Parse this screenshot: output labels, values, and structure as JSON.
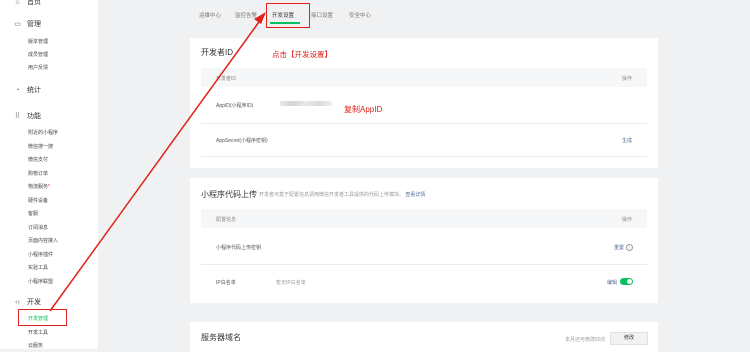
{
  "sidebar": {
    "top_partial": "首页",
    "manage": {
      "label": "管理",
      "items": [
        "版本管理",
        "成员管理",
        "用户反馈"
      ]
    },
    "stats": {
      "label": "统计"
    },
    "features": {
      "label": "功能",
      "items": [
        "附近的小程序",
        "微信搜一搜",
        "微信支付",
        "购物订单",
        "物流服务",
        "硬件设备",
        "客服",
        "订阅消息",
        "页面内容接入",
        "小程序插件",
        "实验工具",
        "小程序联盟"
      ]
    },
    "dev": {
      "label": "开发",
      "items": [
        "开发管理",
        "开发工具",
        "云服务"
      ]
    },
    "asterisk": "*"
  },
  "tabs": [
    "运维中心",
    "监控告警",
    "开发设置",
    "接口设置",
    "安全中心"
  ],
  "developer_card": {
    "title": "开发者ID",
    "th_left": "开发者ID",
    "th_right": "操作",
    "rows": [
      {
        "label": "AppID(小程序ID)",
        "action": ""
      },
      {
        "label": "AppSecret(小程序密钥)",
        "action": "生成"
      }
    ]
  },
  "upload_card": {
    "title": "小程序代码上传",
    "desc": "开发者可基于配置信息调用微信开发者工具提供的代码上传模块。",
    "desc_link": "查看详情",
    "th_left": "配置信息",
    "th_right": "操作",
    "rows": [
      {
        "label": "小程序代码上传密钥",
        "action": "重置"
      },
      {
        "label": "IP白名单",
        "value": "暂无IP白名单",
        "action": "编辑"
      }
    ],
    "toggle_on": true
  },
  "server_card": {
    "title": "服务器域名",
    "remaining": "本月还可修改50次",
    "button": "修改"
  },
  "annotations": {
    "click_dev": "点击【开发设置】",
    "copy_appid": "复制AppID"
  },
  "colors": {
    "accent": "#07c160",
    "link": "#576b95",
    "annot": "#e0211b"
  }
}
